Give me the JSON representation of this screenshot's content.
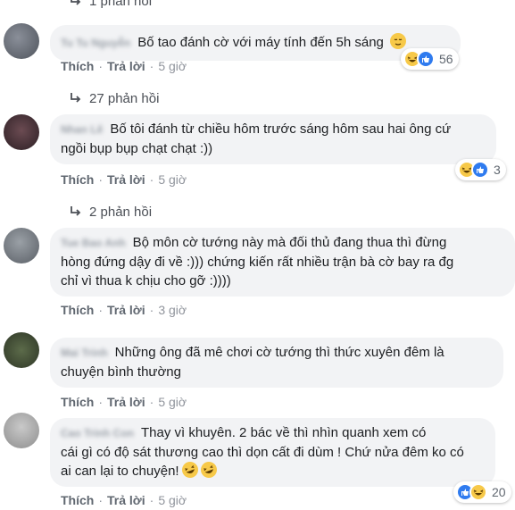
{
  "top_partial_toggle": {
    "label": "1 phản hồi"
  },
  "comments": [
    {
      "author": "Tu Tu Nguyễn",
      "text": "Bố tao đánh cờ với máy tính đến 5h sáng",
      "trailing_emoji": "relieved-face",
      "actions": {
        "like": "Thích",
        "reply": "Trả lời",
        "time": "5 giờ"
      },
      "reactions": {
        "icons": [
          "haha",
          "like"
        ],
        "count": "56"
      },
      "replies_toggle": "27 phản hồi"
    },
    {
      "author": "Nhan Lê",
      "text_lines": [
        "Bố tôi đánh từ chiều hôm trước sáng hôm sau hai ông cứ",
        "ngồi bụp bụp chạt chạt :))"
      ],
      "actions": {
        "like": "Thích",
        "reply": "Trả lời",
        "time": "5 giờ"
      },
      "reactions": {
        "icons": [
          "haha",
          "like"
        ],
        "count": "3"
      },
      "replies_toggle": "2 phản hồi"
    },
    {
      "author": "Tue Bao Anh",
      "text_lines": [
        "Bộ môn cờ tướng này mà đối thủ đang thua thì đừng",
        "hòng đứng dậy đi về :))) chứng kiến rất nhiều trận bà cờ bay ra đg",
        "chỉ vì thua k chịu cho gỡ :))))"
      ],
      "actions": {
        "like": "Thích",
        "reply": "Trả lời",
        "time": "3 giờ"
      }
    },
    {
      "author": "Mai Trinh",
      "text_lines": [
        "Những ông đã mê chơi cờ tướng thì thức xuyên đêm là",
        "chuyện bình thường"
      ],
      "actions": {
        "like": "Thích",
        "reply": "Trả lời",
        "time": "5 giờ"
      }
    },
    {
      "author": "Cao Trinh Con",
      "text_lines": [
        "Thay vì khuyên. 2 bác về thì nhìn quanh xem có",
        "cái gì có độ sát thương cao thì dọn cất đi dùm ! Chứ nửa đêm ko có",
        "ai can lại to chuyện!"
      ],
      "trailing_emojis": [
        "rofl",
        "rofl"
      ],
      "actions": {
        "like": "Thích",
        "reply": "Trả lời",
        "time": "5 giờ"
      },
      "reactions": {
        "icons": [
          "like",
          "haha"
        ],
        "count": "20"
      }
    }
  ],
  "colors": {
    "bubble": "#f2f3f5",
    "action_text": "#606770",
    "like_blue": "#2f7bef",
    "haha_yellow": "#f7c949"
  }
}
